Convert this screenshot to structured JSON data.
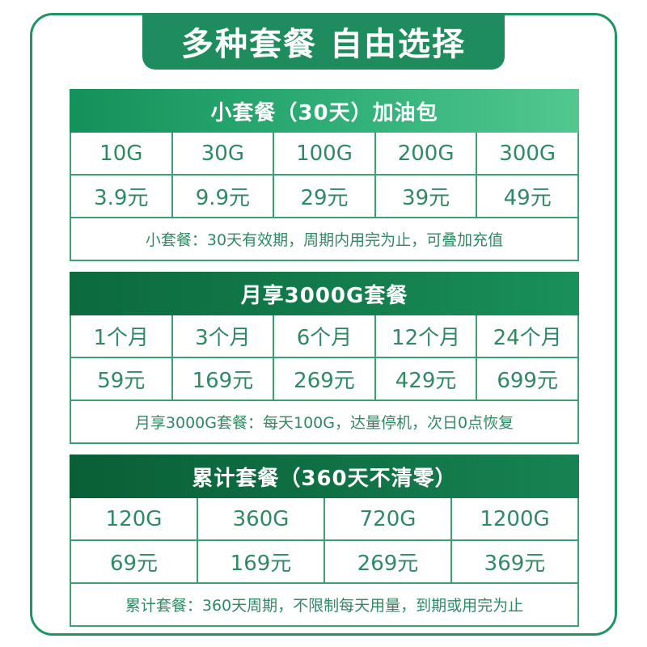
{
  "banner": {
    "title": "多种套餐 自由选择"
  },
  "sections": [
    {
      "title": "小套餐（30天）加油包",
      "sizes": [
        "10G",
        "30G",
        "100G",
        "200G",
        "300G"
      ],
      "prices": [
        "3.9元",
        "9.9元",
        "29元",
        "39元",
        "49元"
      ],
      "note": "小套餐：30天有效期，周期内用完为止，可叠加充值"
    },
    {
      "title": "月享3000G套餐",
      "sizes": [
        "1个月",
        "3个月",
        "6个月",
        "12个月",
        "24个月"
      ],
      "prices": [
        "59元",
        "169元",
        "269元",
        "429元",
        "699元"
      ],
      "note": "月享3000G套餐：每天100G，达量停机，次日0点恢复"
    },
    {
      "title": "累计套餐（360天不清零）",
      "sizes": [
        "120G",
        "360G",
        "720G",
        "1200G"
      ],
      "prices": [
        "69元",
        "169元",
        "269元",
        "369元"
      ],
      "note": "累计套餐：360天周期，不限制每天用量，到期或用完为止"
    }
  ],
  "colors": {
    "brand_green": "#1e8c5c",
    "text_green": "#2f8a63",
    "border_green": "#3da074"
  }
}
